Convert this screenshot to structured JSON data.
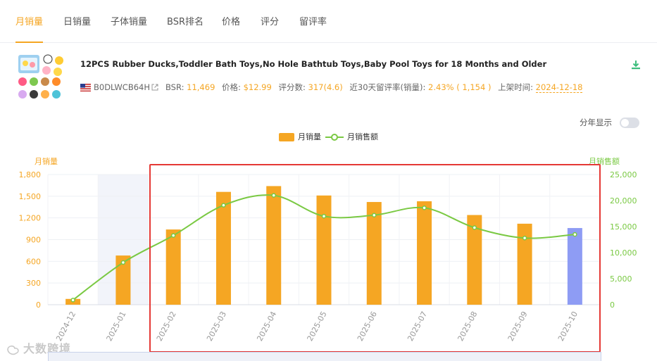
{
  "tabs": [
    {
      "label": "月销量",
      "active": true
    },
    {
      "label": "日销量",
      "active": false
    },
    {
      "label": "子体销量",
      "active": false
    },
    {
      "label": "BSR排名",
      "active": false
    },
    {
      "label": "价格",
      "active": false
    },
    {
      "label": "评分",
      "active": false
    },
    {
      "label": "留评率",
      "active": false
    }
  ],
  "product": {
    "title": "12PCS Rubber Ducks,Toddler Bath Toys,No Hole Bathtub Toys,Baby Pool Toys for 18 Months and Older",
    "asin": "B0DLWCB64H",
    "bsr_label": "BSR:",
    "bsr_value": "11,469",
    "price_label": "价格:",
    "price_value": "$12.99",
    "reviews_label": "评分数:",
    "reviews_value": "317(4.6)",
    "review_rate_label": "近30天留评率(销量):",
    "review_rate_value": "2.43% ( 1,154 )",
    "launch_label": "上架时间:",
    "launch_value": "2024-12-18"
  },
  "toggle": {
    "label": "分年显示",
    "on": false
  },
  "legend": {
    "bar": "月销量",
    "line": "月销售额"
  },
  "axes": {
    "left_title": "月销量",
    "right_title": "月销售额"
  },
  "colors": {
    "bar": "#f5a623",
    "bar_highlight": "#8e9cf4",
    "line": "#7ac943",
    "highlight_box": "#e53935"
  },
  "watermark": "大数跨境",
  "chart_data": {
    "type": "bar",
    "categories": [
      "2024-12",
      "2025-01",
      "2025-02",
      "2025-03",
      "2025-04",
      "2025-05",
      "2025-06",
      "2025-07",
      "2025-08",
      "2025-09",
      "2025-10"
    ],
    "series": [
      {
        "name": "月销量",
        "type": "bar",
        "axis": "left",
        "values": [
          80,
          680,
          1040,
          1560,
          1640,
          1510,
          1420,
          1430,
          1240,
          1120,
          1060
        ]
      },
      {
        "name": "月销售额",
        "type": "line",
        "axis": "right",
        "values": [
          900,
          8100,
          13300,
          19100,
          21000,
          17000,
          17200,
          18600,
          14800,
          12800,
          13500
        ]
      }
    ],
    "y_left": {
      "min": 0,
      "max": 1800,
      "ticks": [
        "0",
        "300",
        "600",
        "900",
        "1,200",
        "1,500",
        "1,800"
      ]
    },
    "y_right": {
      "min": 0,
      "max": 25000,
      "ticks": [
        "0",
        "5,000",
        "10,000",
        "15,000",
        "20,000",
        "25,000"
      ]
    },
    "highlighted_category": "2025-10",
    "grid": true
  }
}
